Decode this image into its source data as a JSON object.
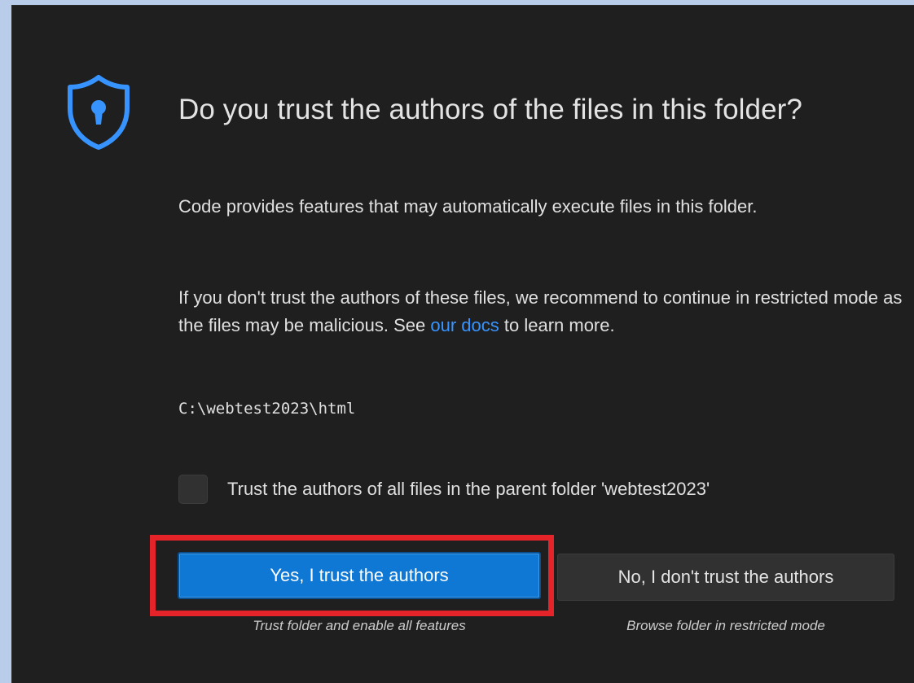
{
  "dialog": {
    "icon": "shield-keyhole-icon",
    "title": "Do you trust the authors of the files in this folder?",
    "paragraph1": "Code provides features that may automatically execute files in this folder.",
    "paragraph2_before": "If you don't trust the authors of these files, we recommend to continue in restricted mode as the files may be malicious. See ",
    "paragraph2_link": "our docs",
    "paragraph2_after": " to learn more.",
    "folder_path": "C:\\webtest2023\\html",
    "checkbox": {
      "label": "Trust the authors of all files in the parent folder 'webtest2023'",
      "checked": false
    },
    "trust_button": {
      "label": "Yes, I trust the authors",
      "description": "Trust folder and enable all features"
    },
    "restricted_button": {
      "label": "No, I don't trust the authors",
      "description": "Browse folder in restricted mode"
    }
  },
  "colors": {
    "background": "#1f1f1f",
    "accent": "#0e78d4",
    "link": "#3794ff",
    "highlight": "#e5242a",
    "page_backdrop": "#b9cdea"
  }
}
